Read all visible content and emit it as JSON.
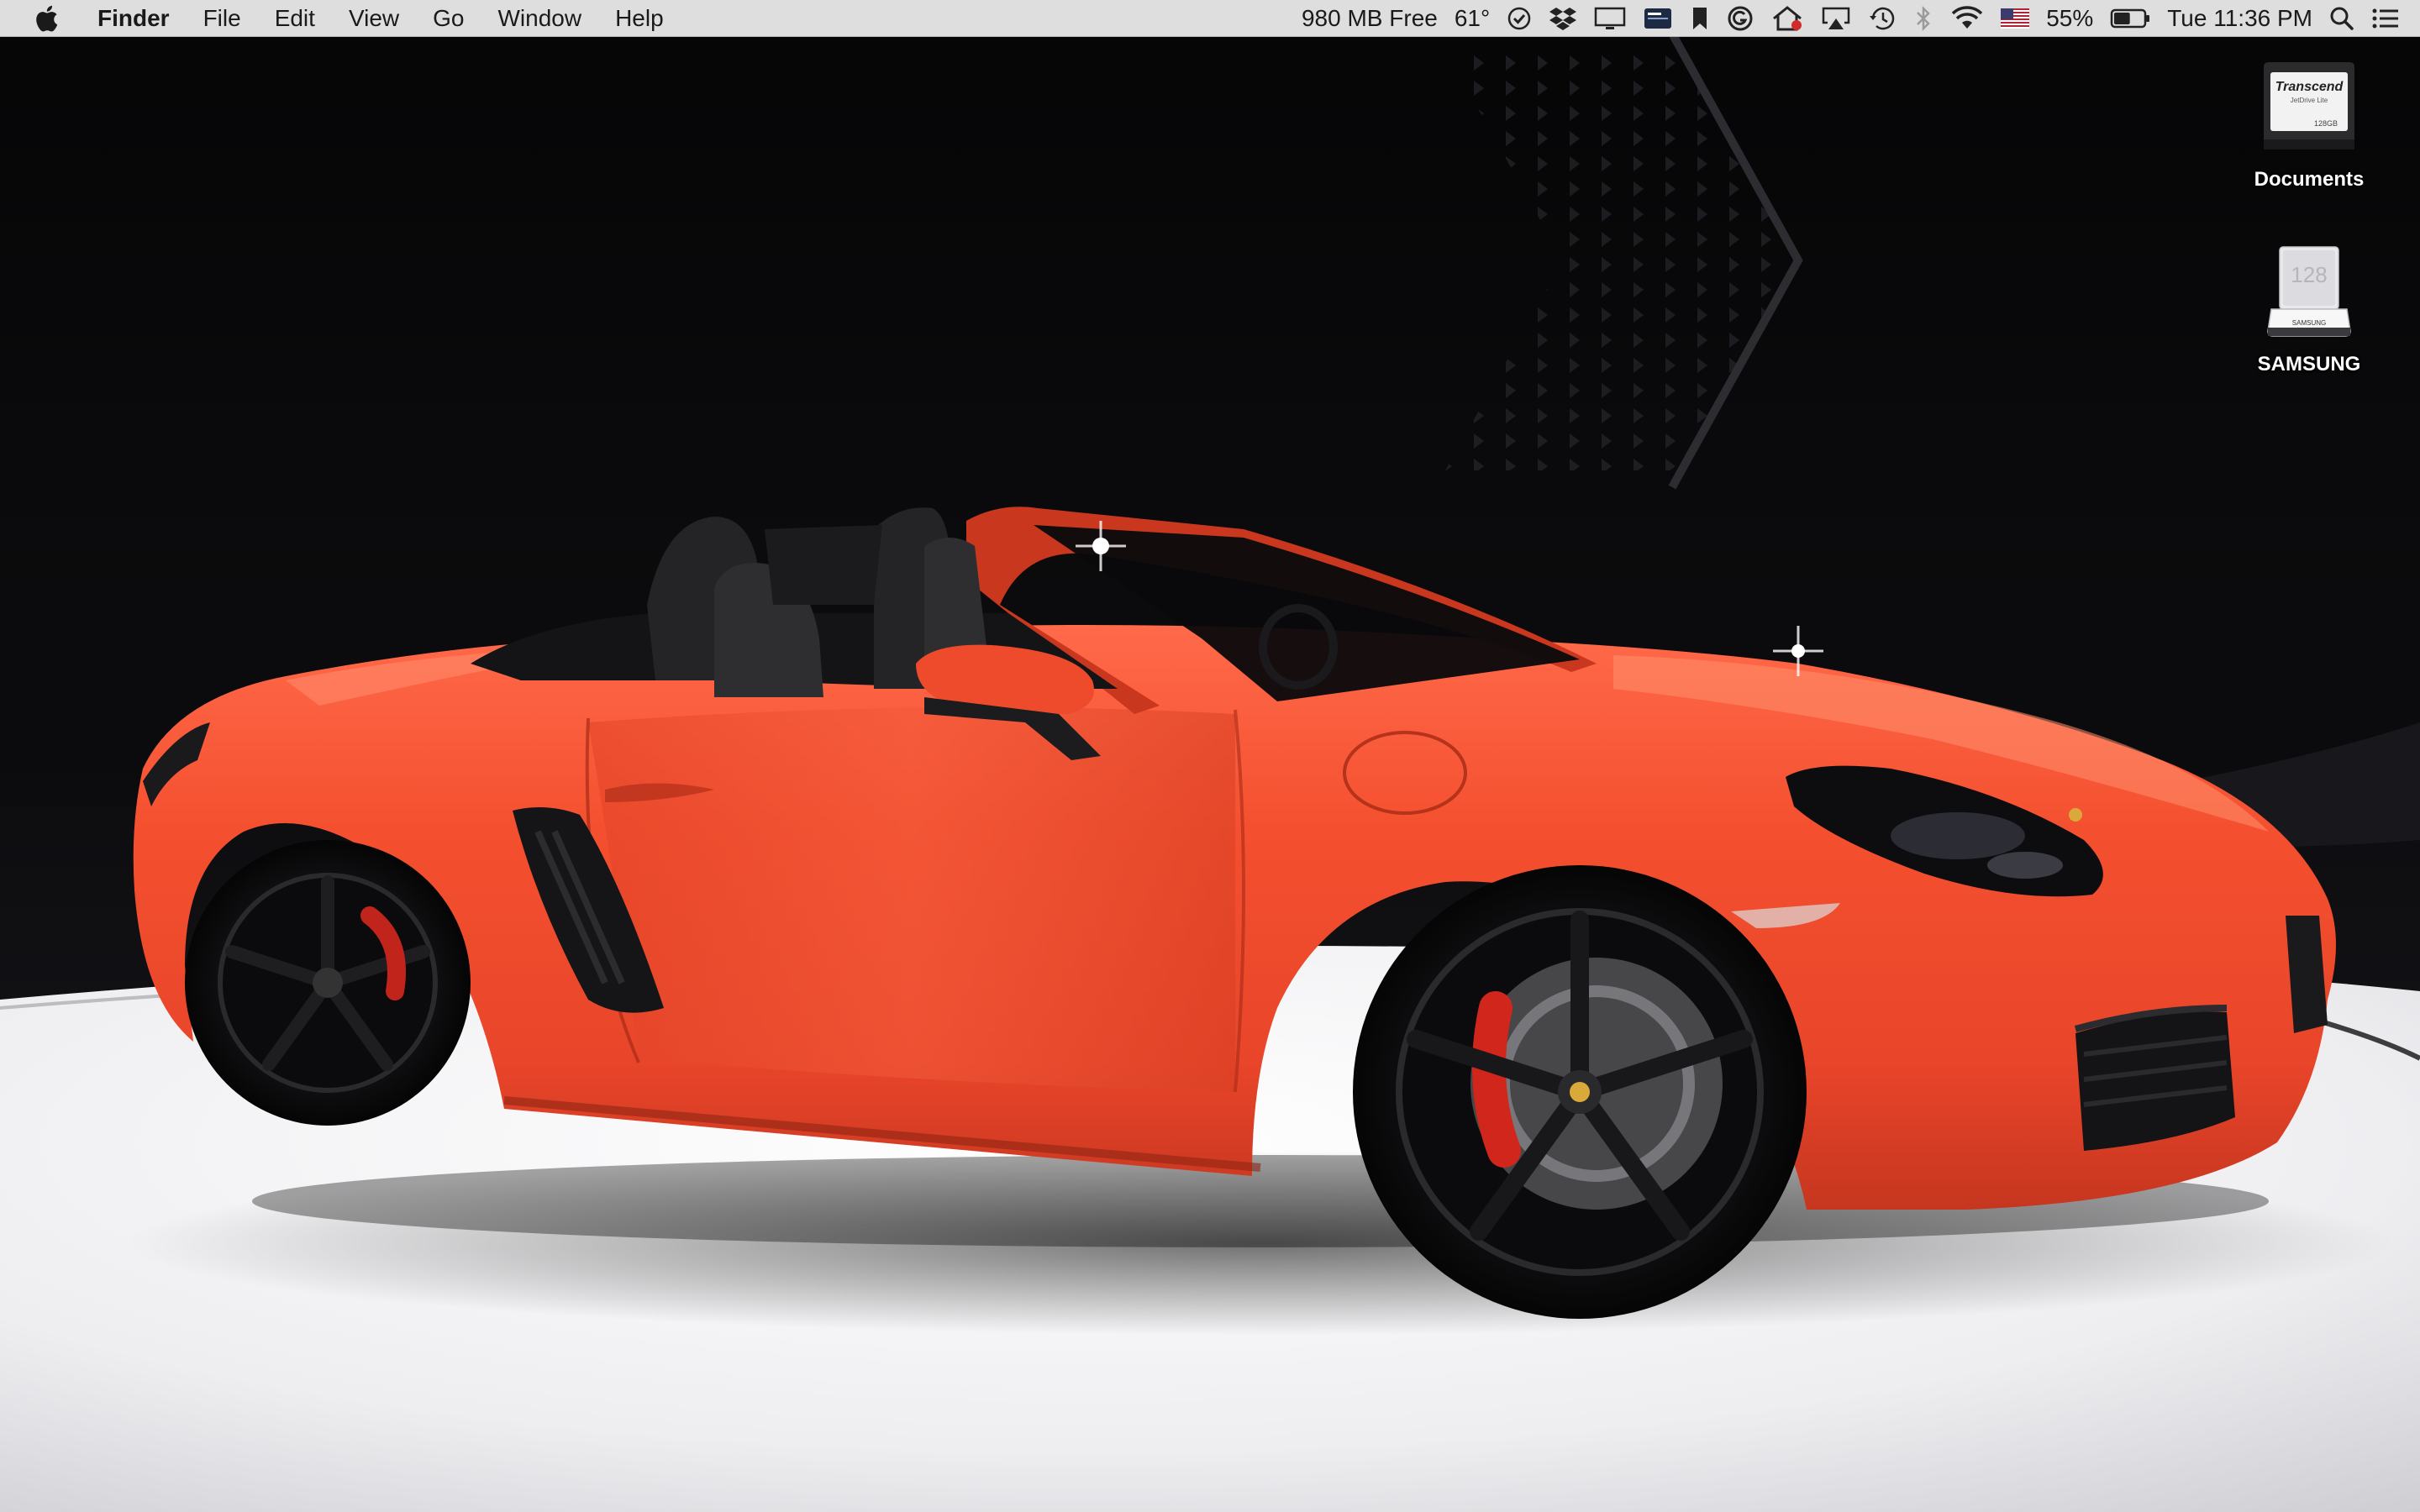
{
  "menubar": {
    "app_name": "Finder",
    "menus": [
      "File",
      "Edit",
      "View",
      "Go",
      "Window",
      "Help"
    ],
    "status": {
      "memory": "980 MB Free",
      "temperature": "61°",
      "battery_percent": "55%",
      "battery_level": 0.55,
      "clock": "Tue 11:36 PM"
    },
    "status_icons": [
      "checkmark-circle-icon",
      "dropbox-icon",
      "display-icon",
      "card-icon",
      "bookmark-icon",
      "grammarly-icon",
      "home-icon",
      "airplay-icon",
      "time-machine-icon",
      "bluetooth-icon",
      "wifi-icon",
      "us-flag-icon",
      "battery-icon",
      "spotlight-icon",
      "notification-center-icon"
    ]
  },
  "desktop_icons": [
    {
      "label": "Documents",
      "type": "sd-card",
      "card_brand": "Transcend",
      "card_model": "JetDrive Lite",
      "card_capacity": "128GB"
    },
    {
      "label": "SAMSUNG",
      "type": "usb-drive",
      "drive_capacity": "128",
      "drive_brand": "SAMSUNG"
    }
  ],
  "colors": {
    "car_body": "#f04c2c",
    "menubar_bg": "#ececec",
    "wallpaper_dark": "#0a0a0c",
    "floor": "#f4f4f6"
  }
}
